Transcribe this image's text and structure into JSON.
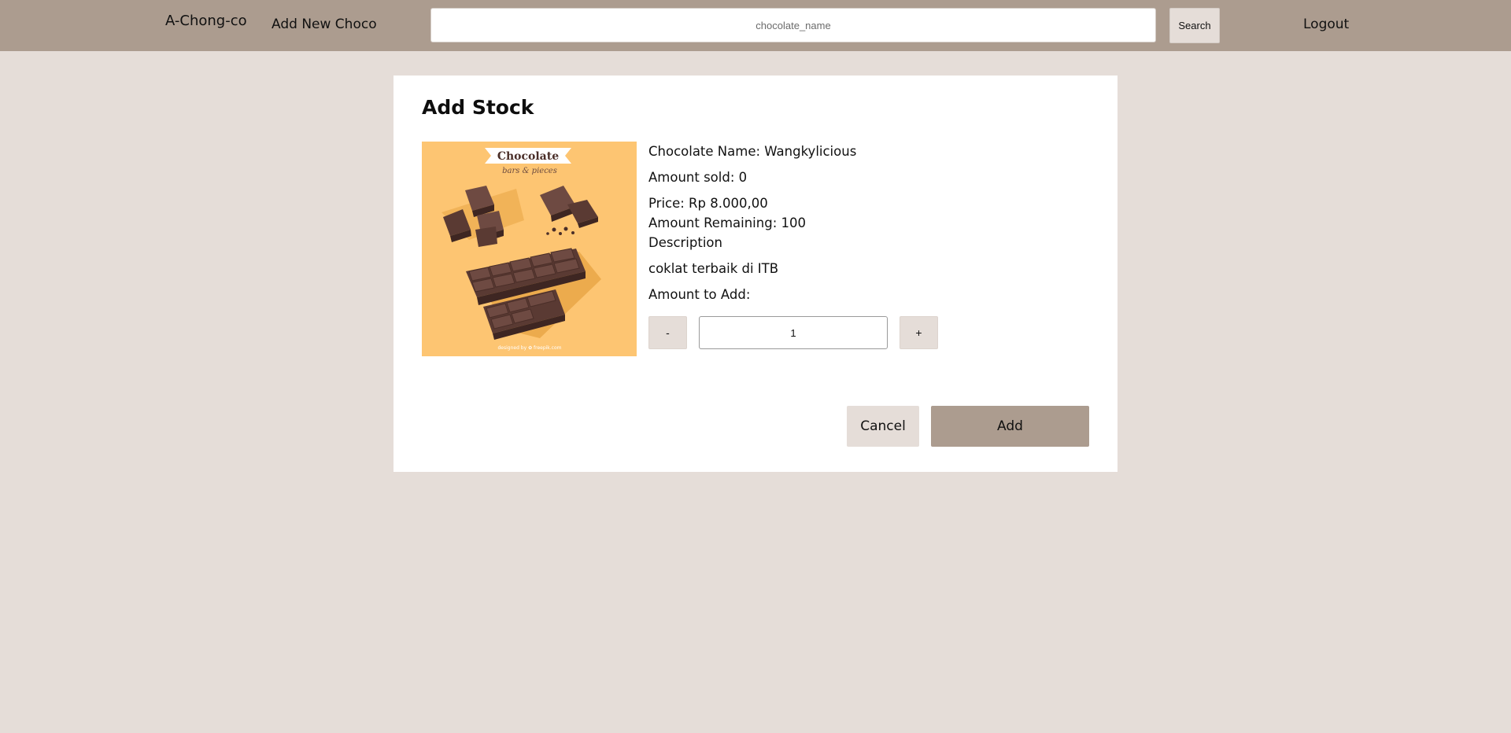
{
  "navbar": {
    "brand": "A-Chong-co",
    "add_new_link": "Add New Choco",
    "search": {
      "placeholder": "chocolate_name",
      "value": "",
      "button_label": "Search"
    },
    "logout_label": "Logout"
  },
  "card": {
    "title": "Add Stock",
    "image": {
      "banner_title": "Chocolate",
      "banner_subtitle": "bars & pieces",
      "credit": "designed by ✿ freepik.com",
      "colors": {
        "background": "#fdc572",
        "shadow": "#e9a647",
        "chocolate": "#5a3a33",
        "chocolate_light": "#6e4a42",
        "chocolate_dark": "#3e2622"
      }
    },
    "details": {
      "name_line": "Chocolate Name: Wangkylicious",
      "sold_line": "Amount sold: 0",
      "price_line": "Price: Rp 8.000,00",
      "remaining_line": "Amount Remaining: 100",
      "description_label": "Description",
      "description_text": "coklat terbaik di ITB",
      "amount_label": "Amount to Add:"
    },
    "quantity": {
      "decrement_label": "-",
      "value": "1",
      "increment_label": "+"
    },
    "actions": {
      "cancel_label": "Cancel",
      "add_label": "Add"
    }
  },
  "colors": {
    "navbar_bg": "#ac9c8f",
    "page_bg": "#e5ddd8",
    "card_bg": "#ffffff",
    "add_button_bg": "#ac9c8f",
    "secondary_button_bg": "#e5ddd8"
  }
}
